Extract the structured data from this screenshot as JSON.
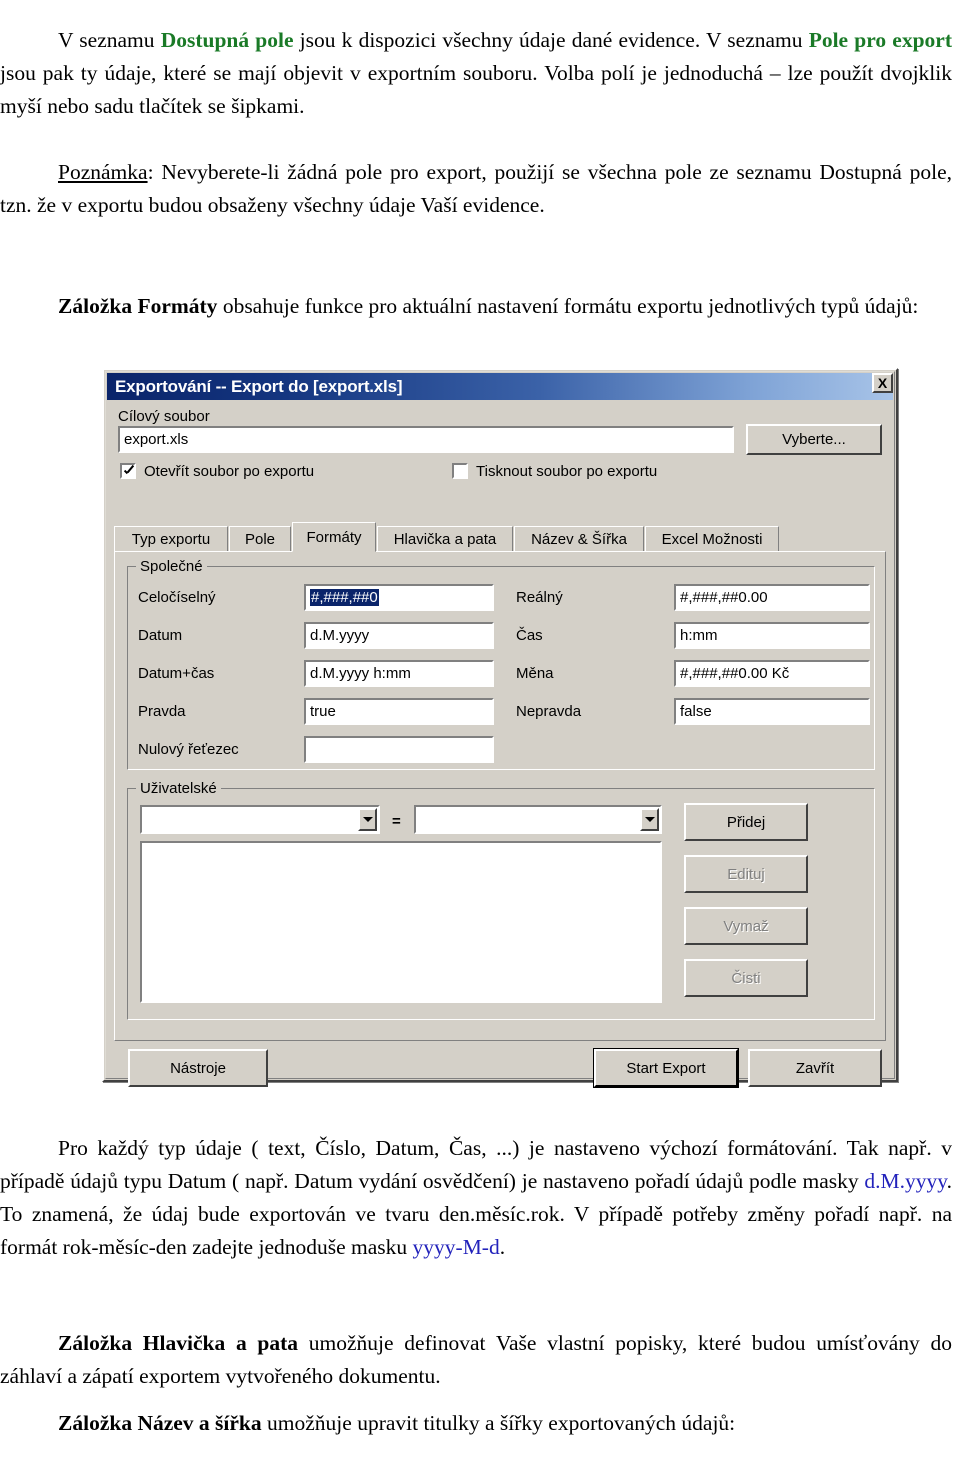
{
  "document": {
    "para_1": {
      "segments": [
        {
          "text": "V seznamu ",
          "style": "normal"
        },
        {
          "text": "Dostupná pole",
          "style": "green"
        },
        {
          "text": " jsou k dispozici všechny údaje dané evidence. V seznamu ",
          "style": "normal"
        },
        {
          "text": "Pole pro export",
          "style": "green"
        },
        {
          "text": " jsou pak ty údaje, které se mají objevit v exportním souboru. Volba polí je jednoduchá – lze použít dvojklik myší nebo sadu tlačítek se šipkami.",
          "style": "normal"
        }
      ]
    },
    "para_2": {
      "note_label": "Poznámka",
      "text": ": Nevyberete-li žádná pole pro export, použijí se všechna pole ze seznamu Dostupná pole, tzn. že v exportu budou obsaženy všechny údaje Vaší evidence."
    },
    "para_3": {
      "bold": "Záložka Formáty",
      "text": " obsahuje funkce pro aktuální nastavení formátu exportu jednotlivých typů údajů:"
    },
    "para_4": {
      "segments": [
        {
          "text": "Pro každý typ údaje ( text, Číslo, Datum, Čas, ...) je nastaveno výchozí formátování. Tak např. v případě údajů typu Datum ( např. Datum vydání osvědčení) je nastaveno pořadí údajů podle masky ",
          "style": "normal"
        },
        {
          "text": "d.M.yyyy",
          "style": "blue"
        },
        {
          "text": ". To znamená, že údaj bude exportován ve tvaru den.měsíc.rok. V případě potřeby změny pořadí např. na formát rok-měsíc-den zadejte jednoduše masku ",
          "style": "normal"
        },
        {
          "text": "yyyy-M-d",
          "style": "blue"
        },
        {
          "text": ".",
          "style": "normal"
        }
      ]
    },
    "para_5": {
      "bold": "Záložka Hlavička a pata",
      "text": " umožňuje definovat Vaše vlastní popisky, které budou umísťovány do záhlaví a zápatí exportem vytvořeného dokumentu."
    },
    "para_6": {
      "bold": "Záložka Název a šířka",
      "text": " umožňuje upravit titulky a šířky exportovaných údajů:"
    }
  },
  "dialog": {
    "title": "Exportování -- Export do [export.xls]",
    "close_label": "X",
    "target_file": {
      "label": "Cílový soubor",
      "value": "export.xls",
      "browse_button": "Vyberte..."
    },
    "checkboxes": [
      {
        "label": "Otevřít soubor po exportu",
        "checked": true
      },
      {
        "label": "Tisknout soubor po exportu",
        "checked": false
      }
    ],
    "tabs": [
      {
        "label": "Typ exportu",
        "active": false
      },
      {
        "label": "Pole",
        "active": false
      },
      {
        "label": "Formáty",
        "active": true
      },
      {
        "label": "Hlavička a pata",
        "active": false
      },
      {
        "label": "Název & Šířka",
        "active": false
      },
      {
        "label": "Excel Možnosti",
        "active": false
      }
    ],
    "common_group": {
      "title": "Společné",
      "left_rows": [
        {
          "label": "Celočíselný",
          "value": "#,###,##0",
          "selected": true
        },
        {
          "label": "Datum",
          "value": "d.M.yyyy",
          "selected": false
        },
        {
          "label": "Datum+čas",
          "value": "d.M.yyyy h:mm",
          "selected": false
        },
        {
          "label": "Pravda",
          "value": "true",
          "selected": false
        },
        {
          "label": "Nulový řeťezec",
          "value": "",
          "selected": false
        }
      ],
      "right_rows": [
        {
          "label": "Reálný",
          "value": "#,###,##0.00"
        },
        {
          "label": "Čas",
          "value": "h:mm"
        },
        {
          "label": "Měna",
          "value": "#,###,##0.00 Kč"
        },
        {
          "label": "Nepravda",
          "value": "false"
        }
      ]
    },
    "user_group": {
      "title": "Uživatelské",
      "equals_sign": "=",
      "combo_left_value": "",
      "combo_right_value": "",
      "list_items": [],
      "buttons": [
        {
          "label": "Přidej",
          "enabled": true
        },
        {
          "label": "Edituj",
          "enabled": false
        },
        {
          "label": "Vymaž",
          "enabled": false
        },
        {
          "label": "Čisti",
          "enabled": false
        }
      ]
    },
    "footer_buttons": {
      "tools": "Nástroje",
      "start_export": "Start Export",
      "close": "Zavřít"
    }
  },
  "colors": {
    "accent_green": "#1a7a27",
    "accent_blue": "#2222bb",
    "title_bar_dark": "#0a246a",
    "dialog_face": "#d4d0c8",
    "selection": "#0a246a"
  }
}
